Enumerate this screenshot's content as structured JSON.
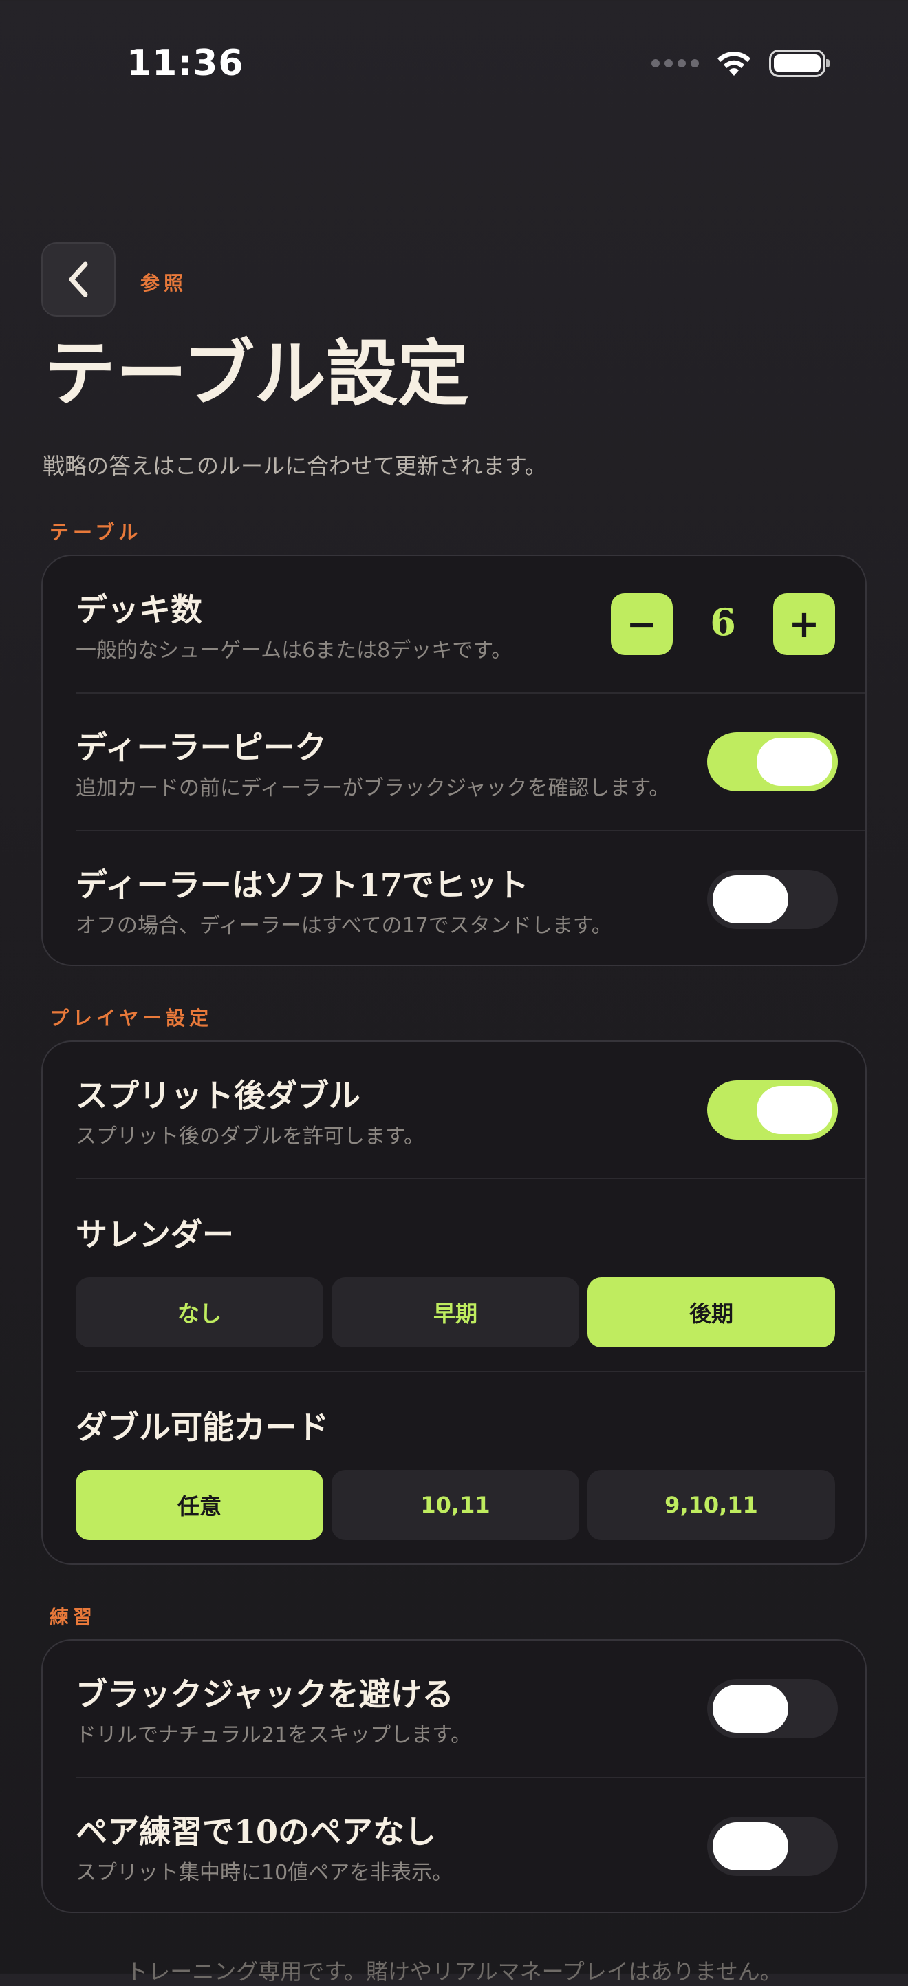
{
  "status_bar": {
    "time": "11:36"
  },
  "nav": {
    "back_label": "参照"
  },
  "header": {
    "title": "テーブル設定",
    "subtitle": "戦略の答えはこのルールに合わせて更新されます。"
  },
  "sections": {
    "table": {
      "header": "テーブル",
      "deck_count": {
        "title": "デッキ数",
        "description": "一般的なシューゲームは6または8デッキです。",
        "value": "6",
        "minus": "−",
        "plus": "+"
      },
      "dealer_peek": {
        "title": "ディーラーピーク",
        "description": "追加カードの前にディーラーがブラックジャックを確認します。",
        "enabled": true
      },
      "hit_soft_17": {
        "title": "ディーラーはソフト17でヒット",
        "description": "オフの場合、ディーラーはすべての17でスタンドします。",
        "enabled": false
      }
    },
    "player": {
      "header": "プレイヤー設定",
      "double_after_split": {
        "title": "スプリット後ダブル",
        "description": "スプリット後のダブルを許可します。",
        "enabled": true
      },
      "surrender": {
        "title": "サレンダー",
        "options": [
          "なし",
          "早期",
          "後期"
        ],
        "selected": "後期"
      },
      "double_cards": {
        "title": "ダブル可能カード",
        "options": [
          "任意",
          "10,11",
          "9,10,11"
        ],
        "selected": "任意"
      }
    },
    "practice": {
      "header": "練習",
      "avoid_blackjack": {
        "title": "ブラックジャックを避ける",
        "description": "ドリルでナチュラル21をスキップします。",
        "enabled": false
      },
      "no_ten_pairs": {
        "title": "ペア練習で10のペアなし",
        "description": "スプリット集中時に10値ペアを非表示。",
        "enabled": false
      }
    }
  },
  "footer": {
    "note": "トレーニング専用です。賭けやリアルマネープレイはありません。"
  },
  "colors": {
    "accent": "#bfec5f",
    "section_header": "#e8793a",
    "background": "#1f1d21",
    "card": "#1a181c"
  }
}
